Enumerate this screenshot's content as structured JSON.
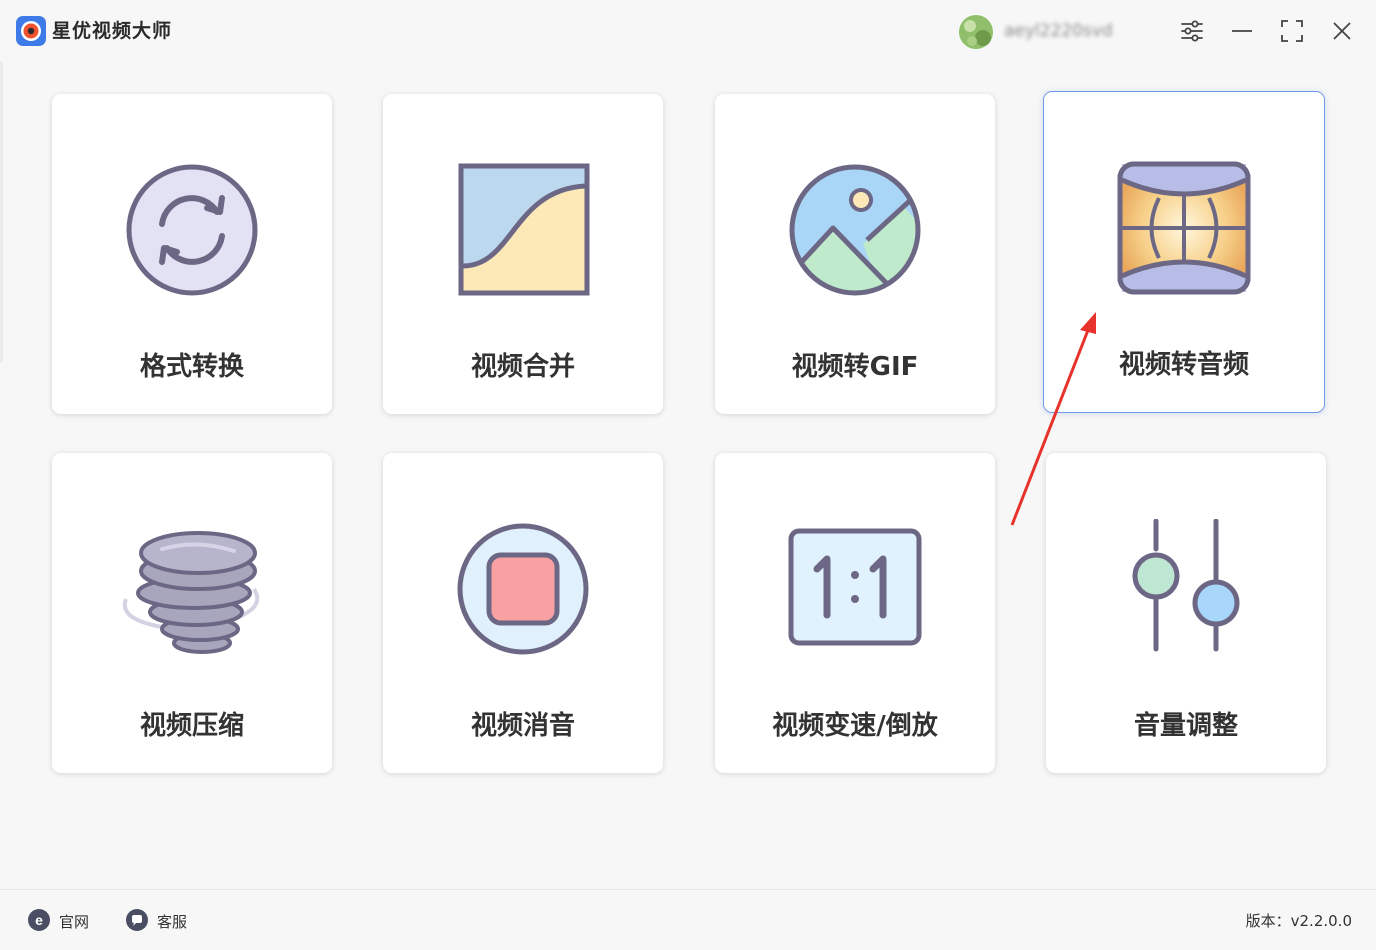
{
  "app": {
    "title": "星优视频大师"
  },
  "user": {
    "name": "aeyl2220svd"
  },
  "cards": [
    {
      "label": "格式转换",
      "icon": "refresh-circle-icon"
    },
    {
      "label": "视频合并",
      "icon": "merge-panel-icon"
    },
    {
      "label": "视频转GIF",
      "icon": "image-landscape-icon"
    },
    {
      "label": "视频转音频",
      "icon": "audio-film-icon"
    },
    {
      "label": "视频压缩",
      "icon": "tornado-icon"
    },
    {
      "label": "视频消音",
      "icon": "mute-stop-icon"
    },
    {
      "label": "视频变速/倒放",
      "icon": "ratio-1-1-icon"
    },
    {
      "label": "音量调整",
      "icon": "sliders-icon"
    }
  ],
  "active_card": "视频转音频",
  "footer": {
    "official_site": "官网",
    "support": "客服",
    "version": "版本：v2.2.0.0"
  },
  "colors": {
    "accent_border": "#6f9be6",
    "annotation_arrow": "#e8322c",
    "icon_stroke": "#6b6784"
  }
}
